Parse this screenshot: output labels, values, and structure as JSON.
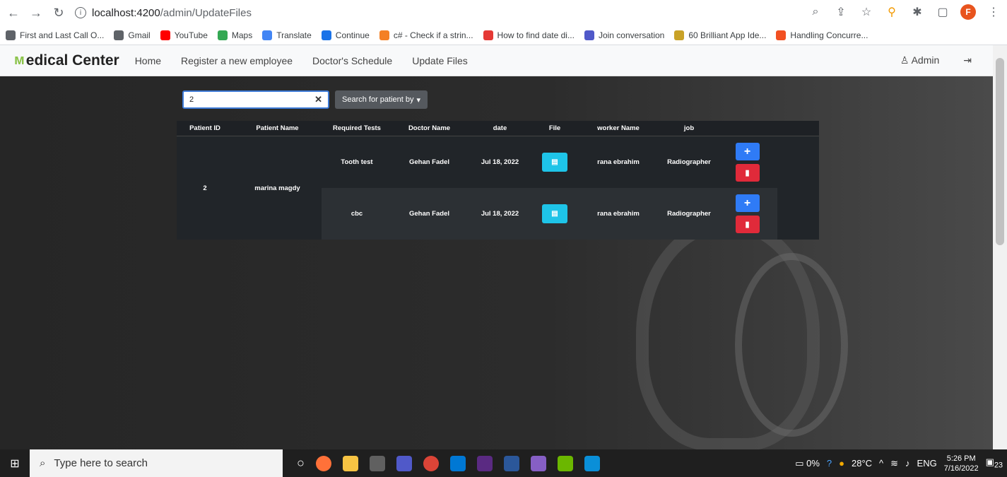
{
  "browser": {
    "url_host": "localhost:4200",
    "url_path": "/admin/UpdateFiles",
    "profile_initial": "F",
    "bookmarks": [
      {
        "label": "First and Last Call O...",
        "color": "#5f6368"
      },
      {
        "label": "Gmail",
        "color": "#5f6368"
      },
      {
        "label": "YouTube",
        "color": "#ff0000"
      },
      {
        "label": "Maps",
        "color": "#34a853"
      },
      {
        "label": "Translate",
        "color": "#4285f4"
      },
      {
        "label": "Continue",
        "color": "#1a73e8"
      },
      {
        "label": "c# - Check if a strin...",
        "color": "#f48024"
      },
      {
        "label": "How to find date di...",
        "color": "#e53935"
      },
      {
        "label": "Join conversation",
        "color": "#5059c9"
      },
      {
        "label": "60 Brilliant App Ide...",
        "color": "#c9a227"
      },
      {
        "label": "Handling Concurre...",
        "color": "#f25022"
      }
    ]
  },
  "app": {
    "brand": "edical Center",
    "nav": [
      "Home",
      "Register a new employee",
      "Doctor's Schedule",
      "Update Files"
    ],
    "admin_label": "Admin"
  },
  "search": {
    "value": "2",
    "search_by_label": "Search for patient by"
  },
  "table": {
    "headers": [
      "Patient ID",
      "Patient Name",
      "Required Tests",
      "Doctor Name",
      "date",
      "File",
      "worker Name",
      "job"
    ],
    "patient_id": "2",
    "patient_name": "marina magdy",
    "rows": [
      {
        "test": "Tooth test",
        "doctor": "Gehan Fadel",
        "date": "Jul 18, 2022",
        "worker": "rana ebrahim",
        "job": "Radiographer"
      },
      {
        "test": "cbc",
        "doctor": "Gehan Fadel",
        "date": "Jul 18, 2022",
        "worker": "rana ebrahim",
        "job": "Radiographer"
      }
    ]
  },
  "taskbar": {
    "search_placeholder": "Type here to search",
    "battery": "0%",
    "weather": "28°C",
    "lang": "ENG",
    "time": "5:26 PM",
    "date": "7/16/2022",
    "notif_count": "23"
  }
}
